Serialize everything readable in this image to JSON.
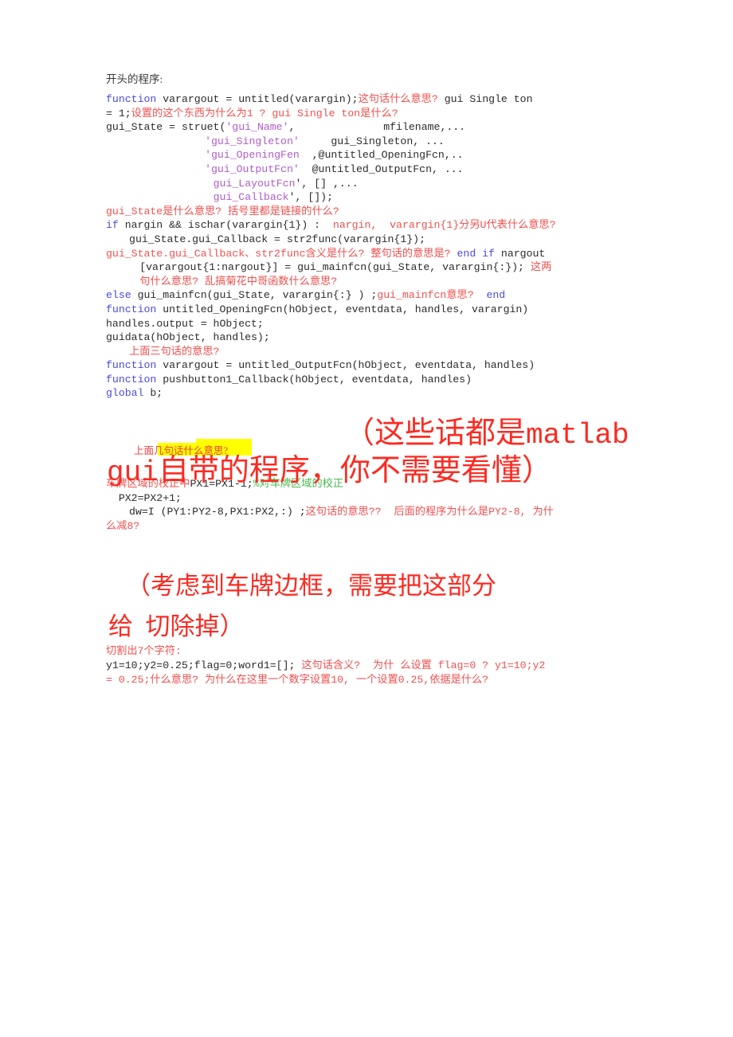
{
  "document": {
    "heading": "开头的程序:",
    "code_block_1": [
      {
        "id": "l1",
        "segments": [
          {
            "cls": "kw",
            "t": "function"
          },
          {
            "cls": "code",
            "t": " varargout = untitled(varargin);"
          },
          {
            "cls": "ann",
            "t": "这句话什么意思?"
          },
          {
            "cls": "code",
            "t": " gui Single ton"
          }
        ]
      },
      {
        "id": "l2",
        "segments": [
          {
            "cls": "code",
            "t": "= 1;"
          },
          {
            "cls": "ann",
            "t": "设置的这个东西为什么为1 ? gui Single ton是什么?"
          }
        ]
      },
      {
        "id": "l3",
        "segments": [
          {
            "cls": "code",
            "t": "gui_State = struet("
          },
          {
            "cls": "str",
            "t": "'gui_Name'"
          },
          {
            "cls": "code",
            "t": ",              mfilename,..."
          }
        ]
      },
      {
        "id": "l4",
        "indent": "indent3",
        "segments": [
          {
            "cls": "str",
            "t": "'gui_Singleton'"
          },
          {
            "cls": "code",
            "t": "     gui_Singleton, ..."
          }
        ]
      },
      {
        "id": "l5",
        "indent": "indent3",
        "segments": [
          {
            "cls": "str",
            "t": "'gui_OpeningFen"
          },
          {
            "cls": "code",
            "t": "  ,@untitled_OpeningFcn,.."
          }
        ]
      },
      {
        "id": "l6",
        "indent": "indent3",
        "segments": [
          {
            "cls": "str",
            "t": "'gui_OutputFcn'"
          },
          {
            "cls": "code",
            "t": "  @untitled_OutputFcn, ..."
          }
        ]
      },
      {
        "id": "l7",
        "indent": "indent4",
        "segments": [
          {
            "cls": "str",
            "t": "gui_LayoutFcn"
          },
          {
            "cls": "code",
            "t": "', [] ,..."
          }
        ]
      },
      {
        "id": "l8",
        "indent": "indent4",
        "segments": [
          {
            "cls": "str",
            "t": "gui_Callback"
          },
          {
            "cls": "code",
            "t": "', []);"
          }
        ]
      },
      {
        "id": "l9",
        "segments": [
          {
            "cls": "ann",
            "t": "gui_State是什么意思? 括号里都是链接的什么?"
          }
        ]
      },
      {
        "id": "l10",
        "segments": [
          {
            "cls": "kw",
            "t": "if"
          },
          {
            "cls": "code",
            "t": " nargin && ischar(varargin{1}) :  "
          },
          {
            "cls": "ann",
            "t": "nargin,  varargin{1}分另U代表什么意思?"
          }
        ]
      },
      {
        "id": "l11",
        "indent": "indent1",
        "segments": [
          {
            "cls": "code",
            "t": "gui_State.gui_Callback = str2func(varargin{1});"
          }
        ]
      },
      {
        "id": "l12",
        "segments": [
          {
            "cls": "ann",
            "t": "gui_State.gui_Callback、str2func含义是什么? 整句话的意思是?"
          },
          {
            "cls": "kw",
            "t": " end if"
          },
          {
            "cls": "code",
            "t": " nargout"
          }
        ]
      },
      {
        "id": "l13",
        "indent": "indent2",
        "segments": [
          {
            "cls": "code",
            "t": "[varargout{1:nargout}] = gui_mainfcn(gui_State, varargin{:});"
          },
          {
            "cls": "ann",
            "t": " 这两"
          }
        ]
      },
      {
        "id": "l14",
        "indent": "indent2",
        "segments": [
          {
            "cls": "ann",
            "t": "句什么意思? 乱搞菊花中哥函数什么意思?"
          }
        ]
      },
      {
        "id": "l15",
        "segments": [
          {
            "cls": "kw",
            "t": "else"
          },
          {
            "cls": "code",
            "t": " gui_mainfcn(gui_State, varargin{:} ) ;"
          },
          {
            "cls": "ann",
            "t": "gui_mainfcn意思?"
          },
          {
            "cls": "kw",
            "t": "  end"
          }
        ]
      },
      {
        "id": "l16",
        "segments": [
          {
            "cls": "kw",
            "t": "function"
          },
          {
            "cls": "code",
            "t": " untitled_OpeningFcn(hObject, eventdata, handles, varargin)"
          }
        ]
      },
      {
        "id": "l17",
        "segments": [
          {
            "cls": "code",
            "t": "handles.output = hObject;"
          }
        ]
      },
      {
        "id": "l18",
        "segments": [
          {
            "cls": "code",
            "t": "guidata(hObject, handles);"
          }
        ]
      },
      {
        "id": "l19",
        "indent": "indent1",
        "segments": [
          {
            "cls": "ann",
            "t": "上面三句话的意思?"
          }
        ]
      },
      {
        "id": "l20",
        "segments": [
          {
            "cls": "kw",
            "t": "function"
          },
          {
            "cls": "code",
            "t": " varargout = untitled_OutputFcn(hObject, eventdata, handles)"
          }
        ]
      },
      {
        "id": "l21",
        "segments": [
          {
            "cls": "kw",
            "t": "function"
          },
          {
            "cls": "code",
            "t": " pushbutton1_Callback(hObject, eventdata, handles)"
          }
        ]
      },
      {
        "id": "l22",
        "segments": [
          {
            "cls": "kw",
            "t": "global"
          },
          {
            "cls": "code",
            "t": " b;"
          }
        ]
      }
    ],
    "overlay_note_small": "上面几句话什么意思?",
    "overlay_big_line1": "（这些话都是",
    "overlay_big_line1_mono": "matlab",
    "overlay_big_line2_mono": "gui",
    "overlay_big_line2": "自带的程序，你不需要看懂）",
    "code_block_2": [
      {
        "id": "m1",
        "segments": [
          {
            "cls": "ann",
            "t": "车牌区域的校正中"
          },
          {
            "cls": "code",
            "t": "PX1=PX1-1;"
          },
          {
            "cls": "cmt",
            "t": "%对车牌区域的校正"
          }
        ]
      },
      {
        "id": "m2",
        "indent": "indent-sm",
        "segments": [
          {
            "cls": "code",
            "t": "PX2=PX2+1;"
          }
        ]
      },
      {
        "id": "m3",
        "indent": "indent1",
        "segments": [
          {
            "cls": "code",
            "t": "dw=I (PY1:PY2-8,PX1:PX2,:) ;"
          },
          {
            "cls": "ann",
            "t": "这句话的意思??  后面的程序为什么是PY2-8, 为什"
          }
        ]
      },
      {
        "id": "m4",
        "segments": [
          {
            "cls": "ann",
            "t": "么减8?"
          }
        ]
      }
    ],
    "overlay_big2_line1": "（考虑到车牌边框，需要把这部分",
    "overlay_big2_line2": "给  切除掉）",
    "code_block_3": [
      {
        "id": "n1",
        "segments": [
          {
            "cls": "ann",
            "t": "切割出7个字符:"
          }
        ]
      },
      {
        "id": "n2",
        "segments": [
          {
            "cls": "code",
            "t": "y1=10;y2=0.25;flag=0;word1=[]; "
          },
          {
            "cls": "ann",
            "t": "这句话含义?  为什 么设置 flag=0 ? y1=10;y2"
          }
        ]
      },
      {
        "id": "n3",
        "segments": [
          {
            "cls": "ann",
            "t": "= 0.25;什么意思? 为什么在这里一个数字设置10, 一个设置0.25,依据是什么?"
          }
        ]
      }
    ],
    "colors": {
      "keyword_blue": "#4a4adf",
      "string_purple": "#b05ccb",
      "annotation_red": "#f0514f",
      "big_red": "#fb2b22",
      "comment_green": "#49b84f",
      "code_black": "#2b2b2b",
      "highlight_yellow": "#ffff00"
    }
  }
}
